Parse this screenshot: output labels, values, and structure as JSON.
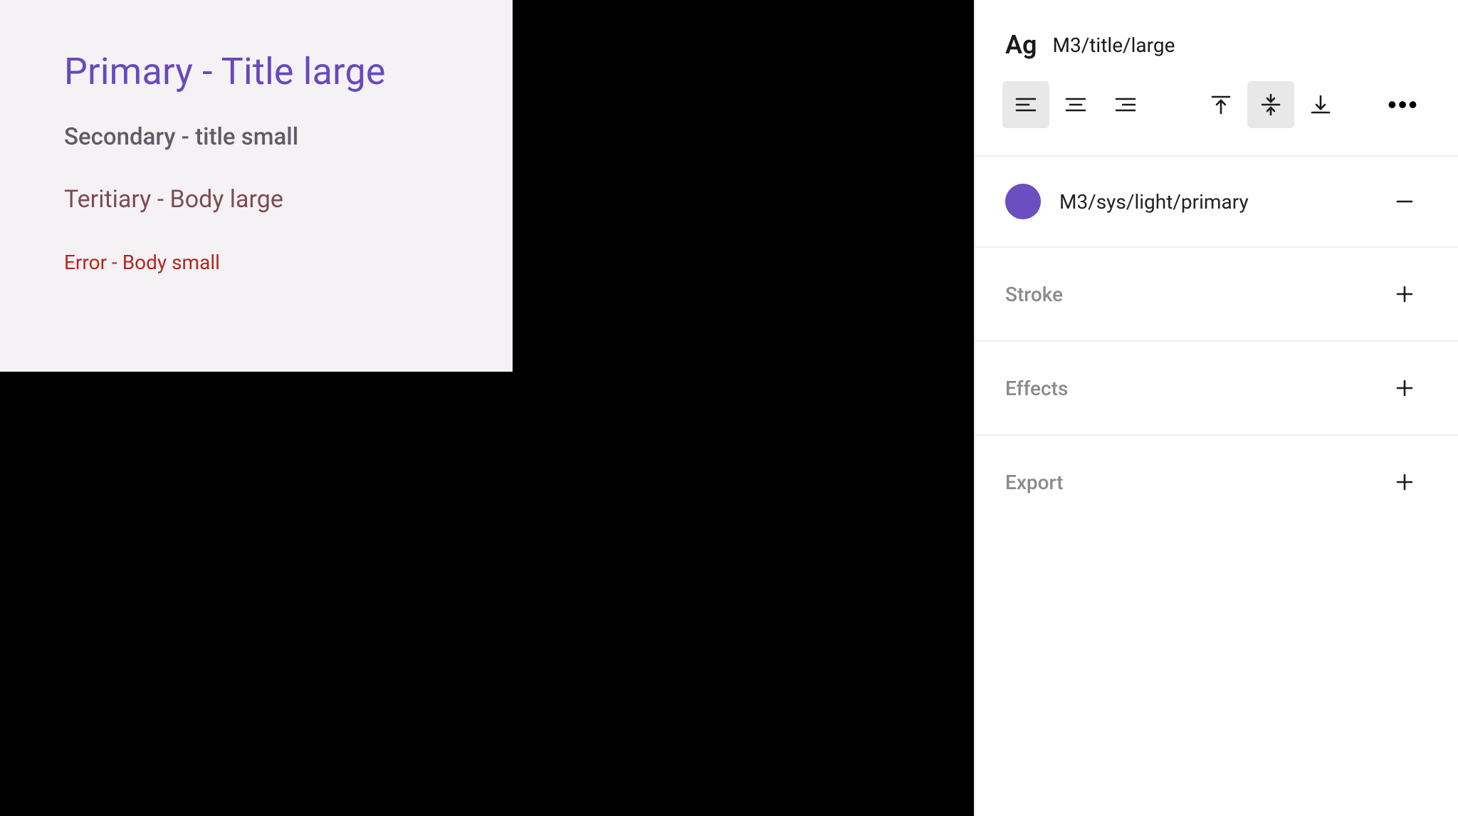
{
  "canvas": {
    "primary": "Primary - Title large",
    "secondary": "Secondary - title small",
    "tertiary": "Teritiary - Body large",
    "error": "Error - Body small"
  },
  "inspector": {
    "ag_glyph": "Ag",
    "text_style": "M3/title/large",
    "fill_style": "M3/sys/light/primary",
    "fill_color": "#6b4fc0",
    "sections": {
      "stroke": "Stroke",
      "effects": "Effects",
      "export": "Export"
    }
  }
}
